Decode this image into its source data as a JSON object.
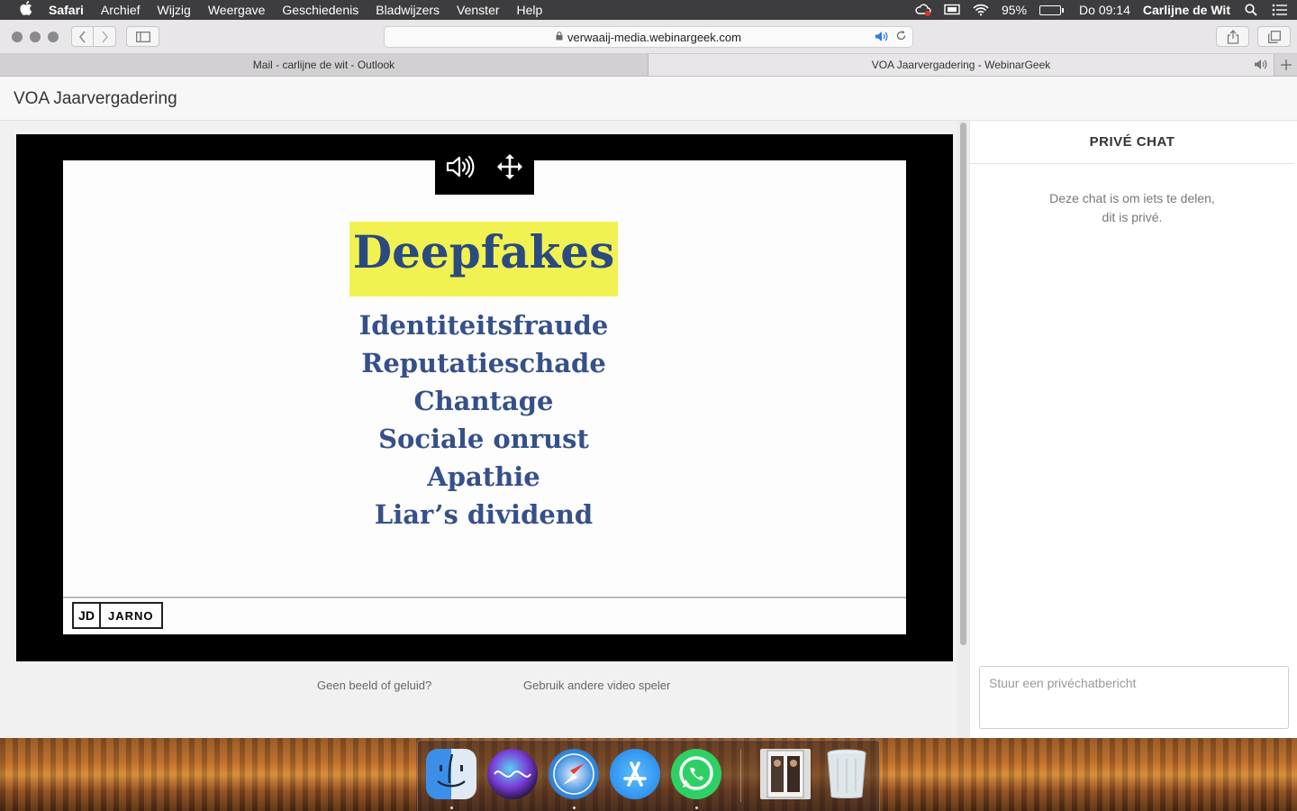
{
  "menubar": {
    "app": "Safari",
    "items": [
      "Archief",
      "Wijzig",
      "Weergave",
      "Geschiedenis",
      "Bladwijzers",
      "Venster",
      "Help"
    ],
    "battery": "95%",
    "clock": "Do 09:14",
    "user": "Carlijne de Wit"
  },
  "browser": {
    "url": "verwaaij-media.webinargeek.com",
    "tabs": [
      {
        "label": "Mail - carlijne de wit - Outlook"
      },
      {
        "label": "VOA Jaarvergadering - WebinarGeek"
      }
    ]
  },
  "page": {
    "title": "VOA Jaarvergadering",
    "slide": {
      "heading": "Deepfakes",
      "items": [
        "Identiteitsfraude",
        "Reputatieschade",
        "Chantage",
        "Sociale onrust",
        "Apathie",
        "Liar’s dividend"
      ],
      "logo_monogram": "JD",
      "logo_text": "JARNO"
    },
    "help_links": {
      "no_picture": "Geen beeld of geluid?",
      "other_player": "Gebruik andere video speler"
    }
  },
  "chat": {
    "title": "PRIVÉ CHAT",
    "info_line1": "Deze chat is om iets te delen,",
    "info_line2": "dit is privé.",
    "input_placeholder": "Stuur een privéchatbericht"
  },
  "dock": {
    "apps": [
      "finder-icon",
      "siri-icon",
      "safari-icon",
      "app-store-icon",
      "whatsapp-icon",
      "photo-stack-icon",
      "trash-icon"
    ]
  },
  "colors": {
    "slide_heading": "#2b4a7f",
    "slide_highlight": "#f1f252",
    "address_speaker": "#2a7de0"
  }
}
